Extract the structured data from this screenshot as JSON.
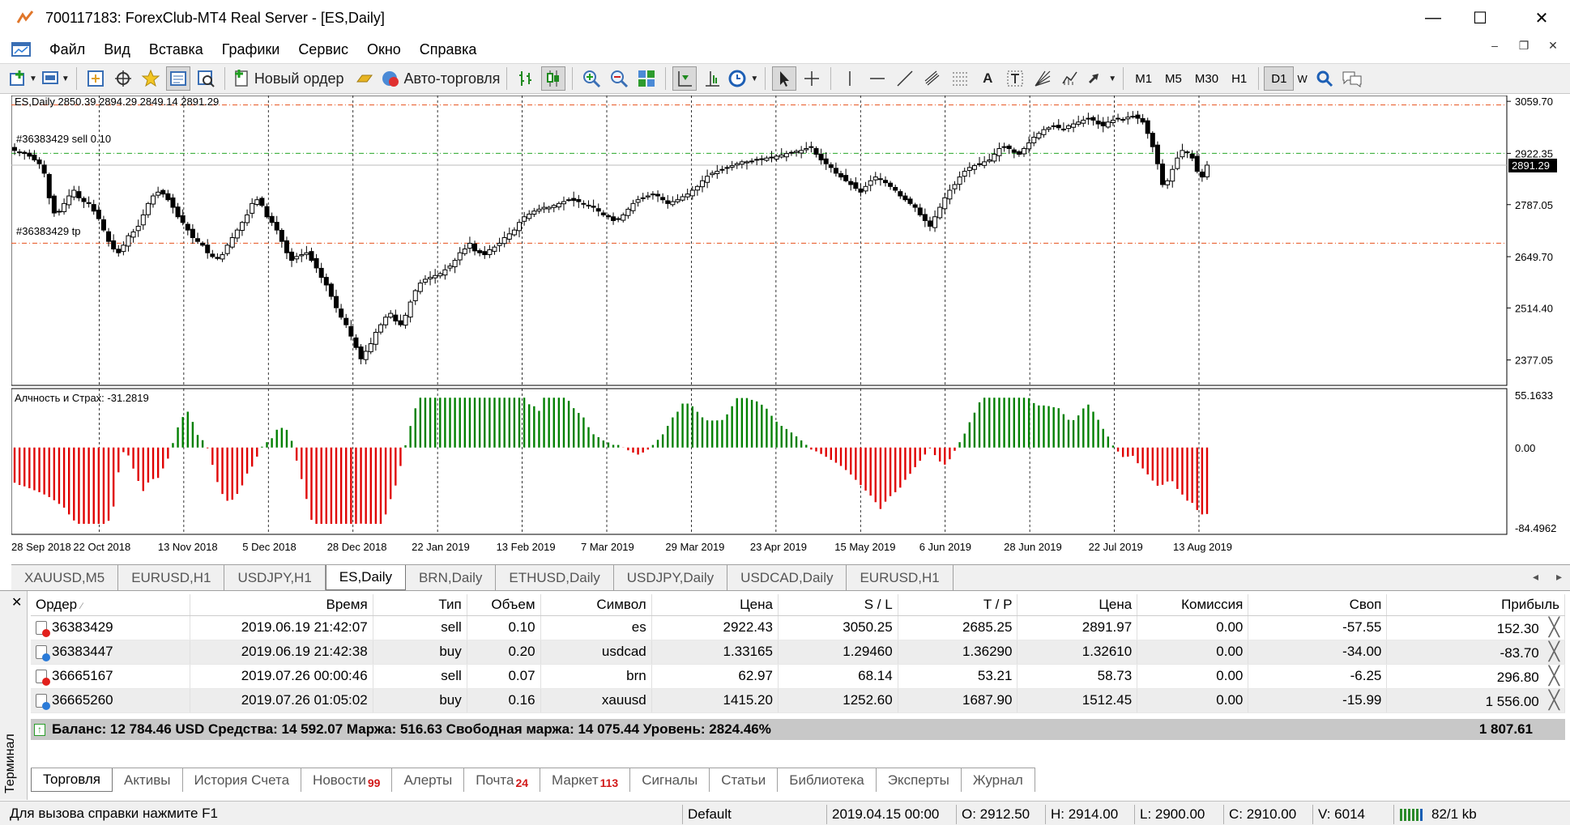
{
  "window": {
    "title": "700117183: ForexClub-MT4 Real Server - [ES,Daily]",
    "controls": {
      "minimize": "—",
      "maximize": "☐",
      "close": "✕"
    }
  },
  "menu": [
    "Файл",
    "Вид",
    "Вставка",
    "Графики",
    "Сервис",
    "Окно",
    "Справка"
  ],
  "toolbar": {
    "new_order": "Новый ордер",
    "auto_trading": "Авто-торговля",
    "timeframes": [
      "M1",
      "M5",
      "M30",
      "H1",
      "D1",
      "W"
    ],
    "active_timeframe": "D1"
  },
  "chart": {
    "header": "ES,Daily  2850.39 2894.29 2849.14 2891.29",
    "order_label_sell": "#36383429 sell 0.10",
    "order_label_tp": "#36383429 tp",
    "indicator_label": "Алчность и Страх: -31.2819",
    "current_price": "2891.29",
    "colors": {
      "bull": "#008000",
      "bear": "#e00000",
      "sl_line": "#e8501c",
      "sell_line": "#27a827",
      "grid": "#000000"
    }
  },
  "chart_data": {
    "type": "candlestick",
    "symbol": "ES",
    "timeframe": "Daily",
    "price_axis_ticks": [
      3059.7,
      2922.35,
      2787.05,
      2649.7,
      2514.4,
      2377.05
    ],
    "ylim": [
      2310,
      3075
    ],
    "levels": {
      "stop_loss": 3050.25,
      "open_price": 2922.43,
      "take_profit": 2685.25,
      "bid": 2891.29
    },
    "date_ticks": [
      "28 Sep 2018",
      "22 Oct 2018",
      "13 Nov 2018",
      "5 Dec 2018",
      "28 Dec 2018",
      "22 Jan 2019",
      "13 Feb 2019",
      "7 Mar 2019",
      "29 Mar 2019",
      "23 Apr 2019",
      "15 May 2019",
      "6 Jun 2019",
      "28 Jun 2019",
      "22 Jul 2019",
      "13 Aug 2019"
    ],
    "closes": [
      2930,
      2925,
      2922,
      2915,
      2905,
      2895,
      2870,
      2805,
      2765,
      2768,
      2790,
      2810,
      2825,
      2805,
      2795,
      2790,
      2770,
      2750,
      2720,
      2690,
      2670,
      2660,
      2680,
      2705,
      2715,
      2730,
      2760,
      2790,
      2810,
      2820,
      2815,
      2800,
      2780,
      2755,
      2740,
      2720,
      2700,
      2690,
      2680,
      2660,
      2650,
      2645,
      2655,
      2680,
      2700,
      2720,
      2740,
      2760,
      2790,
      2800,
      2785,
      2755,
      2740,
      2720,
      2690,
      2660,
      2640,
      2650,
      2655,
      2660,
      2640,
      2620,
      2595,
      2575,
      2545,
      2515,
      2490,
      2470,
      2440,
      2410,
      2380,
      2400,
      2420,
      2450,
      2470,
      2490,
      2500,
      2480,
      2470,
      2495,
      2530,
      2560,
      2580,
      2590,
      2595,
      2600,
      2605,
      2615,
      2625,
      2640,
      2660,
      2670,
      2685,
      2665,
      2660,
      2655,
      2668,
      2675,
      2685,
      2700,
      2710,
      2720,
      2740,
      2755,
      2762,
      2770,
      2775,
      2780,
      2780,
      2785,
      2790,
      2795,
      2800,
      2798,
      2795,
      2790,
      2785,
      2780,
      2770,
      2760,
      2755,
      2745,
      2750,
      2760,
      2775,
      2790,
      2800,
      2805,
      2810,
      2815,
      2810,
      2800,
      2790,
      2795,
      2800,
      2808,
      2815,
      2825,
      2835,
      2850,
      2862,
      2870,
      2875,
      2880,
      2885,
      2890,
      2895,
      2900,
      2900,
      2902,
      2905,
      2908,
      2910,
      2912,
      2915,
      2918,
      2922,
      2925,
      2928,
      2930,
      2935,
      2940,
      2920,
      2905,
      2895,
      2885,
      2870,
      2860,
      2850,
      2840,
      2830,
      2820,
      2835,
      2850,
      2860,
      2855,
      2845,
      2835,
      2825,
      2810,
      2800,
      2790,
      2780,
      2760,
      2745,
      2730,
      2755,
      2780,
      2805,
      2825,
      2840,
      2860,
      2875,
      2885,
      2890,
      2895,
      2900,
      2905,
      2920,
      2935,
      2940,
      2935,
      2925,
      2920,
      2935,
      2950,
      2965,
      2975,
      2985,
      2990,
      2995,
      2990,
      2985,
      2995,
      3000,
      3005,
      3010,
      3015,
      3010,
      3000,
      2995,
      3005,
      3010,
      3015,
      3012,
      3018,
      3020,
      3015,
      3005,
      2975,
      2940,
      2895,
      2840,
      2850,
      2880,
      2910,
      2930,
      2925,
      2910,
      2875,
      2860,
      2891.29
    ],
    "indicator_axis_ticks": [
      55.1633,
      0.0,
      -84.4962
    ],
    "indicator_name": "Алчность и Страх",
    "indicator_value": -31.2819
  },
  "chart_tabs": [
    "XAUUSD,M5",
    "EURUSD,H1",
    "USDJPY,H1",
    "ES,Daily",
    "BRN,Daily",
    "ETHUSD,Daily",
    "USDJPY,Daily",
    "USDCAD,Daily",
    "EURUSD,H1"
  ],
  "active_chart_tab": "ES,Daily",
  "terminal": {
    "vertical_label": "Терминал",
    "columns": [
      "Ордер",
      "Время",
      "Тип",
      "Объем",
      "Символ",
      "Цена",
      "S / L",
      "T / P",
      "Цена",
      "Комиссия",
      "Своп",
      "Прибыль"
    ],
    "rows": [
      {
        "order": "36383429",
        "time": "2019.06.19 21:42:07",
        "type": "sell",
        "volume": "0.10",
        "symbol": "es",
        "price": "2922.43",
        "sl": "3050.25",
        "tp": "2685.25",
        "cur": "2891.97",
        "commission": "0.00",
        "swap": "-57.55",
        "profit": "152.30"
      },
      {
        "order": "36383447",
        "time": "2019.06.19 21:42:38",
        "type": "buy",
        "volume": "0.20",
        "symbol": "usdcad",
        "price": "1.33165",
        "sl": "1.29460",
        "tp": "1.36290",
        "cur": "1.32610",
        "commission": "0.00",
        "swap": "-34.00",
        "profit": "-83.70"
      },
      {
        "order": "36665167",
        "time": "2019.07.26 00:00:46",
        "type": "sell",
        "volume": "0.07",
        "symbol": "brn",
        "price": "62.97",
        "sl": "68.14",
        "tp": "53.21",
        "cur": "58.73",
        "commission": "0.00",
        "swap": "-6.25",
        "profit": "296.80"
      },
      {
        "order": "36665260",
        "time": "2019.07.26 01:05:02",
        "type": "buy",
        "volume": "0.16",
        "symbol": "xauusd",
        "price": "1415.20",
        "sl": "1252.60",
        "tp": "1687.90",
        "cur": "1512.45",
        "commission": "0.00",
        "swap": "-15.99",
        "profit": "1 556.00"
      }
    ],
    "balance_line": "Баланс: 12 784.46 USD  Средства: 14 592.07  Маржа: 516.63  Свободная маржа: 14 075.44  Уровень: 2824.46%",
    "total_profit": "1 807.61",
    "tabs": [
      {
        "label": "Торговля",
        "count": ""
      },
      {
        "label": "Активы",
        "count": ""
      },
      {
        "label": "История Счета",
        "count": ""
      },
      {
        "label": "Новости",
        "count": "99"
      },
      {
        "label": "Алерты",
        "count": ""
      },
      {
        "label": "Почта",
        "count": "24"
      },
      {
        "label": "Маркет",
        "count": "113"
      },
      {
        "label": "Сигналы",
        "count": ""
      },
      {
        "label": "Статьи",
        "count": ""
      },
      {
        "label": "Библиотека",
        "count": ""
      },
      {
        "label": "Эксперты",
        "count": ""
      },
      {
        "label": "Журнал",
        "count": ""
      }
    ]
  },
  "status": {
    "help": "Для вызова справки нажмите F1",
    "profile": "Default",
    "datetime": "2019.04.15 00:00",
    "open": "O: 2912.50",
    "high": "H: 2914.00",
    "low": "L: 2900.00",
    "close": "C: 2910.00",
    "volume": "V: 6014",
    "traffic": "82/1 kb"
  }
}
